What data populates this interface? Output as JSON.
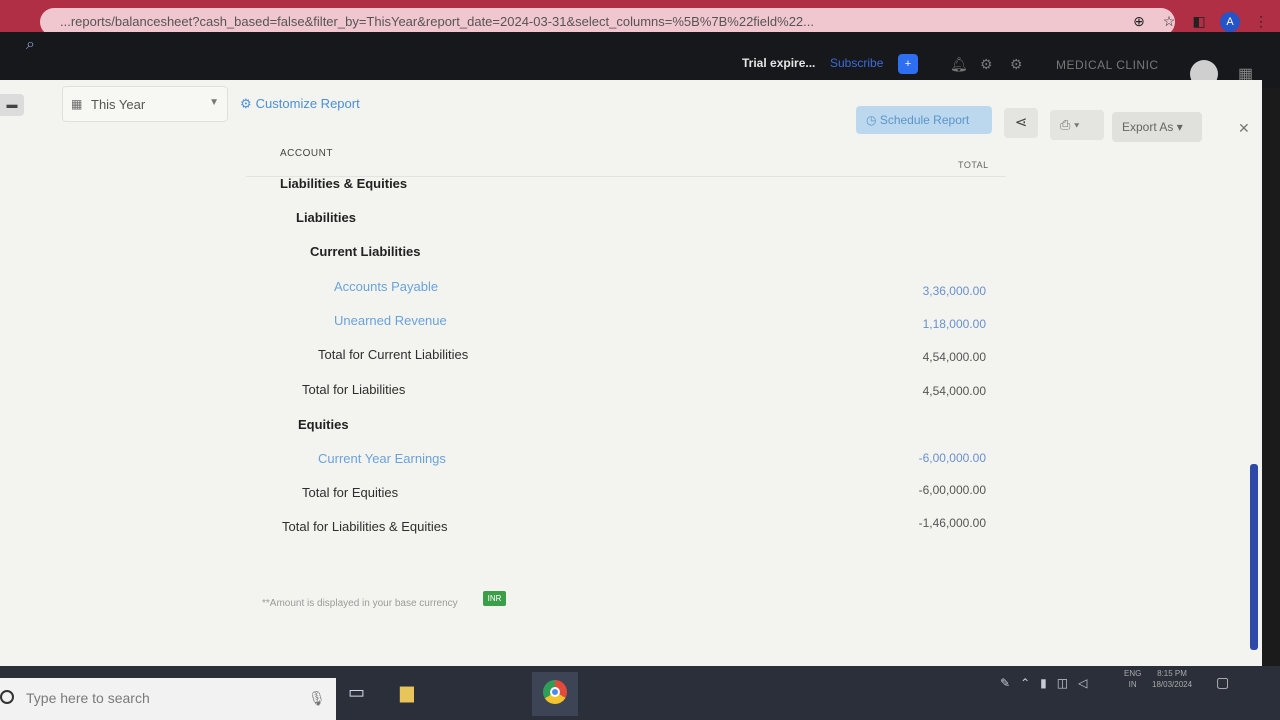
{
  "browser": {
    "url": "...reports/balancesheet?cash_based=false&filter_by=ThisYear&report_date=2024-03-31&select_columns=%5B%7B%22field%22...",
    "profile_initial": "A"
  },
  "app_header": {
    "trial_text": "Trial expire...",
    "subscribe_label": "Subscribe",
    "org_name": "MEDICAL CLINIC"
  },
  "toolbar": {
    "period_label": "This Year",
    "customize_label": "Customize Report",
    "schedule_label": "Schedule Report",
    "export_label": "Export As"
  },
  "report": {
    "column_account": "ACCOUNT",
    "column_total": "TOTAL",
    "rows": [
      {
        "label": "Liabilities & Equities",
        "amount": ""
      },
      {
        "label": "Liabilities",
        "amount": ""
      },
      {
        "label": "Current Liabilities",
        "amount": ""
      },
      {
        "label": "Accounts Payable",
        "amount": "3,36,000.00"
      },
      {
        "label": "Unearned Revenue",
        "amount": "1,18,000.00"
      },
      {
        "label": "Total for Current Liabilities",
        "amount": "4,54,000.00"
      },
      {
        "label": "Total for Liabilities",
        "amount": "4,54,000.00"
      },
      {
        "label": "Equities",
        "amount": ""
      },
      {
        "label": "Current Year Earnings",
        "amount": "-6,00,000.00"
      },
      {
        "label": "Total for Equities",
        "amount": "-6,00,000.00"
      },
      {
        "label": "Total for Liabilities & Equities",
        "amount": "-1,46,000.00"
      }
    ],
    "footnote": "**Amount is displayed in your base currency",
    "currency_code": "INR"
  },
  "taskbar": {
    "search_placeholder": "Type here to search",
    "lang_line1": "ENG",
    "lang_line2": "IN",
    "time": "8:15 PM",
    "date": "18/03/2024"
  }
}
